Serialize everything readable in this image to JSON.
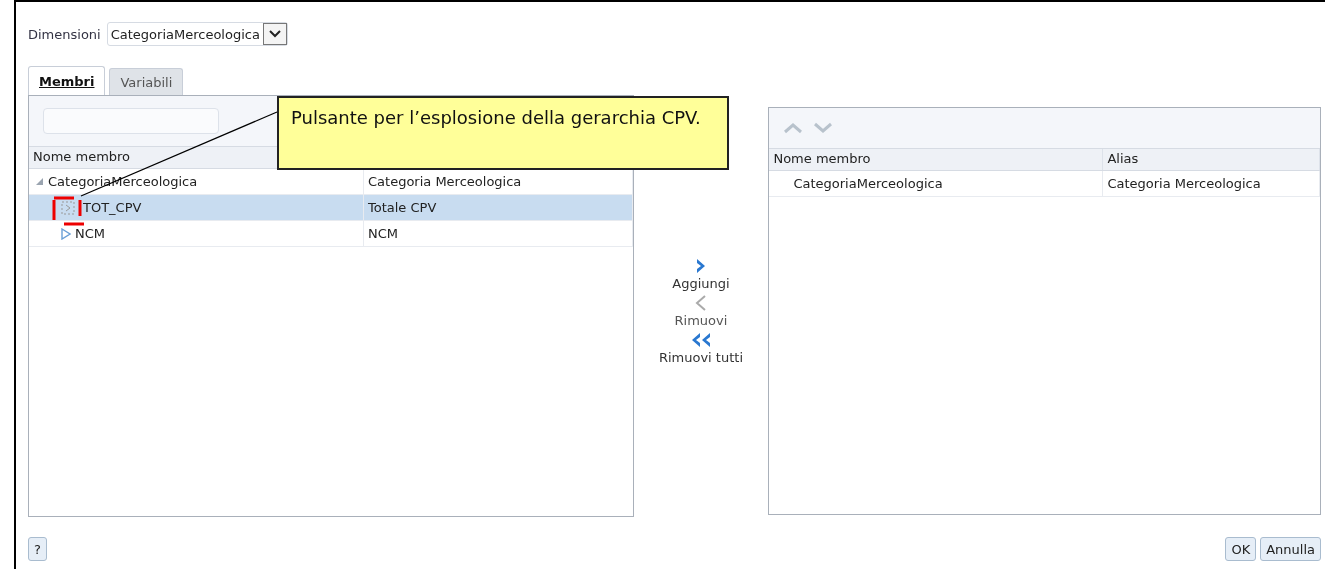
{
  "dimension": {
    "label": "Dimensioni",
    "value": "CategoriaMerceologica"
  },
  "tabs": [
    {
      "label": "Membri",
      "selected": true
    },
    {
      "label": "Variabili",
      "selected": false
    }
  ],
  "left_panel": {
    "columns": [
      "Nome membro"
    ],
    "tree": [
      {
        "name": "CategoriaMerceologica",
        "alias": "Categoria Merceologica",
        "expanded": true,
        "selected": false,
        "children": [
          {
            "name": "TOT_CPV",
            "alias": "Totale CPV",
            "kind": "pending",
            "selected": true
          },
          {
            "name": "NCM",
            "alias": "NCM",
            "kind": "collapsed",
            "selected": false
          }
        ]
      }
    ]
  },
  "callout": {
    "text": "Pulsante per l’esplosione della gerarchia CPV."
  },
  "transfer_buttons": [
    {
      "label": "Aggiungi",
      "kind": "add",
      "disabled": false
    },
    {
      "label": "Rimuovi",
      "kind": "remove",
      "disabled": true
    },
    {
      "label": "Rimuovi tutti",
      "kind": "remove_all",
      "disabled": false
    }
  ],
  "right_panel": {
    "columns": [
      "Nome membro",
      "Alias"
    ],
    "rows": [
      [
        "CategoriaMerceologica",
        "Categoria Merceologica"
      ]
    ]
  },
  "help_button": "?",
  "footer_buttons": [
    "OK",
    "Annulla"
  ]
}
